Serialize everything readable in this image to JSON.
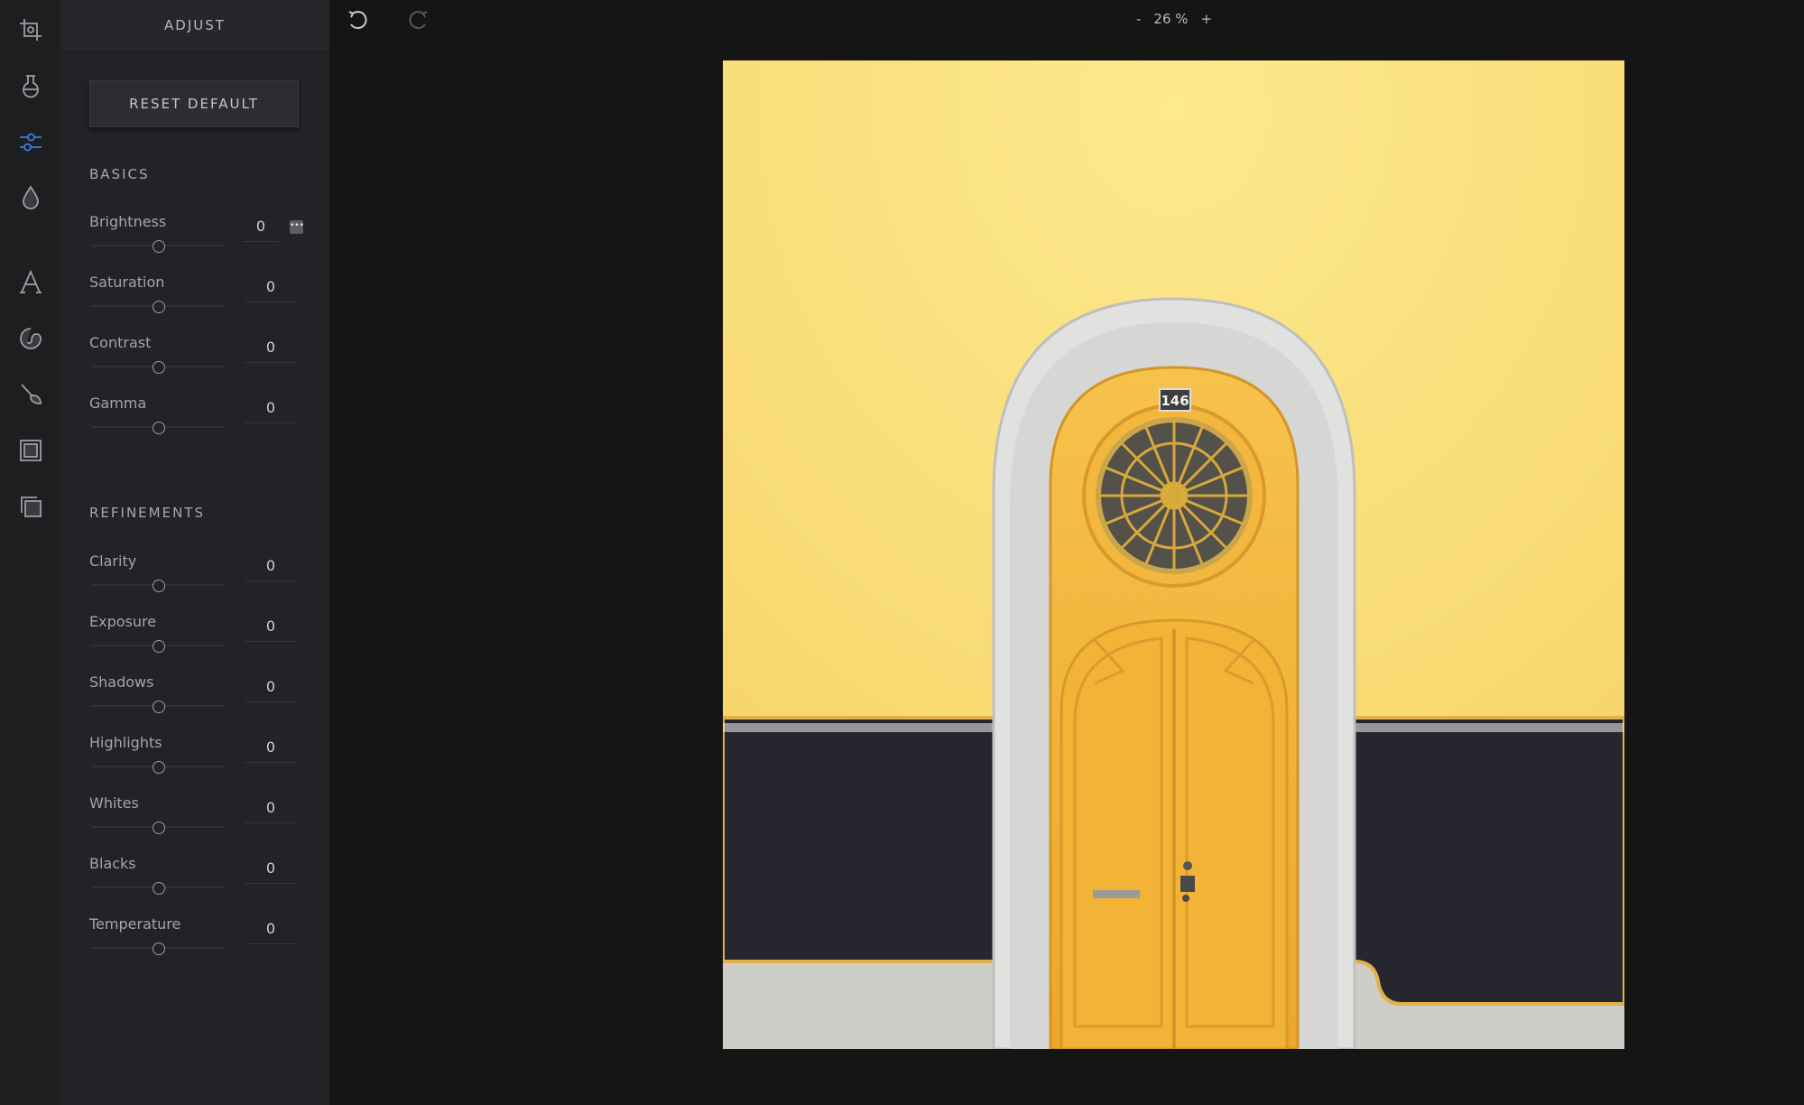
{
  "app": {
    "rail_icons": [
      "crop-icon",
      "filter-icon",
      "adjust-sliders-icon",
      "color-drop-icon",
      "text-icon",
      "sticker-icon",
      "brush-icon",
      "frame-icon",
      "overlay-icon"
    ],
    "active_tool": "adjust-sliders-icon",
    "accent": "#3d7fe0"
  },
  "panel": {
    "title": "ADJUST",
    "reset_label": "RESET DEFAULT",
    "basics_title": "BASICS",
    "refinements_title": "REFINEMENTS",
    "basics": [
      {
        "label": "Brightness",
        "value": "0"
      },
      {
        "label": "Saturation",
        "value": "0"
      },
      {
        "label": "Contrast",
        "value": "0"
      },
      {
        "label": "Gamma",
        "value": "0"
      }
    ],
    "refinements": [
      {
        "label": "Clarity",
        "value": "0"
      },
      {
        "label": "Exposure",
        "value": "0"
      },
      {
        "label": "Shadows",
        "value": "0"
      },
      {
        "label": "Highlights",
        "value": "0"
      },
      {
        "label": "Whites",
        "value": "0"
      },
      {
        "label": "Blacks",
        "value": "0"
      },
      {
        "label": "Temperature",
        "value": "0"
      }
    ],
    "more_icon": "ellipsis-icon"
  },
  "topbar": {
    "undo_icon": "undo-icon",
    "redo_icon": "redo-icon",
    "zoom_out": "-",
    "zoom_level": "26 %",
    "zoom_in": "+"
  },
  "canvas": {
    "house_number": "146",
    "colors": {
      "wall": "#f7d76f",
      "door": "#f2b236",
      "trim": "#dcdcdc",
      "base_panel": "#24252e"
    }
  }
}
